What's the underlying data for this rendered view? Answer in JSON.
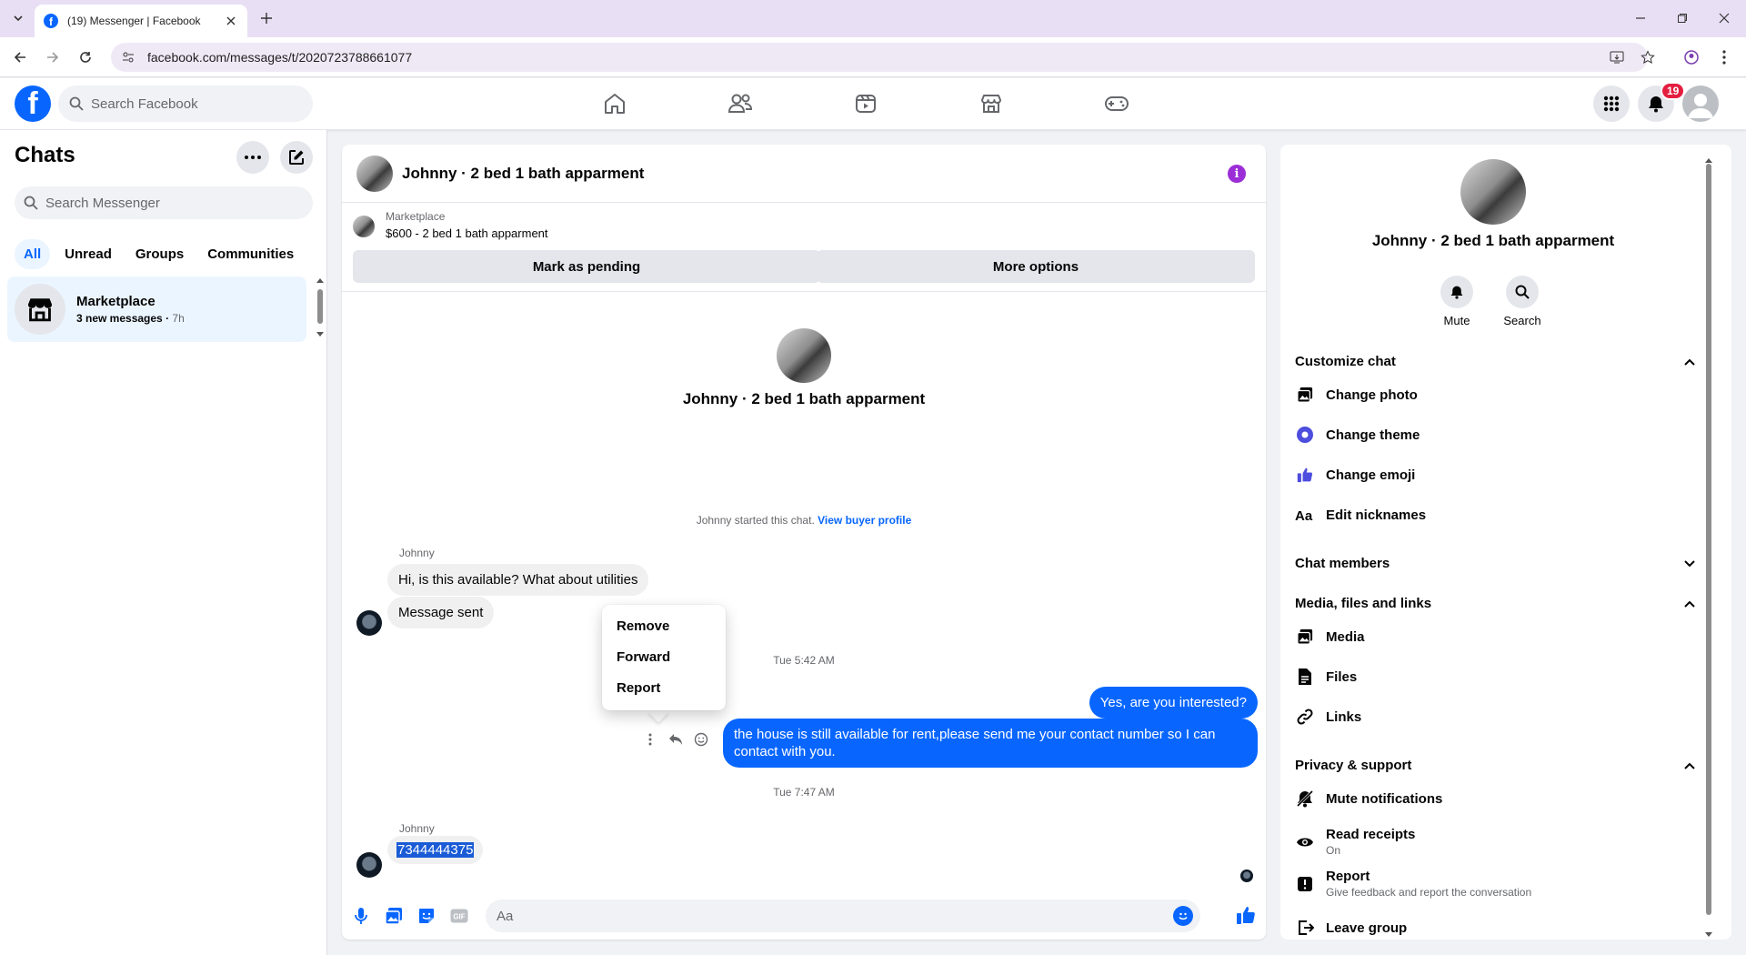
{
  "browser": {
    "tab_title": "(19) Messenger | Facebook",
    "url": "facebook.com/messages/t/2020723788661077"
  },
  "header": {
    "search_placeholder": "Search Facebook",
    "notification_count": "19",
    "brand_color": "#0866ff"
  },
  "sidebar": {
    "title": "Chats",
    "search_placeholder": "Search Messenger",
    "filters": [
      "All",
      "Unread",
      "Groups",
      "Communities"
    ],
    "active_filter": "All",
    "chats": [
      {
        "name": "Marketplace",
        "preview": "3 new messages",
        "time": "7h"
      }
    ]
  },
  "chat": {
    "title": "Johnny · 2 bed 1 bath apparment",
    "marketplace_label": "Marketplace",
    "listing": "$600 - 2 bed 1 bath apparment",
    "mark_pending": "Mark as pending",
    "more_options": "More options",
    "intro_name": "Johnny · 2 bed 1 bath apparment",
    "started_text": "Johnny started this chat.",
    "view_profile": "View buyer profile",
    "messages": {
      "sender1": "Johnny",
      "in1": "Hi, is this available? What about utilities",
      "in2": "Message sent",
      "time1": "Tue 5:42 AM",
      "out1": "Yes, are you interested?",
      "out2": "the house is still available for rent,please send me your contact number so I can contact with you.",
      "time2": "Tue 7:47 AM",
      "sender2": "Johnny",
      "in3": "7344444375"
    },
    "context_menu": [
      "Remove",
      "Forward",
      "Report"
    ],
    "composer_placeholder": "Aa"
  },
  "details": {
    "name": "Johnny · 2 bed 1 bath apparment",
    "mute": "Mute",
    "search": "Search",
    "customize": "Customize chat",
    "change_photo": "Change photo",
    "change_theme": "Change theme",
    "change_emoji": "Change emoji",
    "edit_nicknames": "Edit nicknames",
    "chat_members": "Chat members",
    "media_files": "Media, files and links",
    "media": "Media",
    "files": "Files",
    "links": "Links",
    "privacy": "Privacy & support",
    "mute_notifications": "Mute notifications",
    "read_receipts": "Read receipts",
    "read_receipts_state": "On",
    "report": "Report",
    "report_sub": "Give feedback and report the conversation",
    "leave": "Leave group"
  }
}
